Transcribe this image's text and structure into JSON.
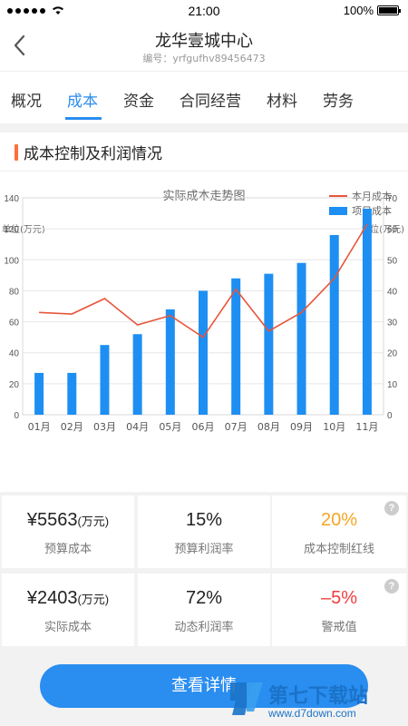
{
  "status_bar": {
    "time": "21:00",
    "battery": "100%"
  },
  "header": {
    "title": "龙华壹城中心",
    "subtitle": "编号：yrfgufhv89456473"
  },
  "tabs": [
    {
      "label": "概况",
      "active": false
    },
    {
      "label": "成本",
      "active": true
    },
    {
      "label": "资金",
      "active": false
    },
    {
      "label": "合同经营",
      "active": false
    },
    {
      "label": "材料",
      "active": false
    },
    {
      "label": "劳务",
      "active": false
    }
  ],
  "section": {
    "title": "成本控制及利润情况"
  },
  "chart_data": {
    "type": "bar",
    "title": "实际成本走势图",
    "categories": [
      "01月",
      "02月",
      "03月",
      "04月",
      "05月",
      "06月",
      "07月",
      "08月",
      "09月",
      "10月",
      "11月"
    ],
    "series": [
      {
        "name": "项目成本",
        "type": "bar",
        "axis": "left",
        "color": "#1e8ff2",
        "values": [
          27,
          27,
          45,
          52,
          68,
          80,
          88,
          91,
          98,
          116,
          133
        ]
      },
      {
        "name": "本月成本",
        "type": "line",
        "axis": "right",
        "color": "#e8553a",
        "values": [
          33,
          32.5,
          37.5,
          29,
          32,
          25,
          40.5,
          27,
          33,
          44,
          61.5
        ]
      }
    ],
    "ylabel_left": "单位(万元)",
    "ylabel_right": "单位(万元)",
    "ylim_left": [
      0,
      140
    ],
    "ylim_right": [
      0,
      70
    ],
    "yticks_left": [
      "0",
      "20",
      "40",
      "60",
      "80",
      "100",
      "120",
      "140"
    ],
    "yticks_right": [
      "0",
      "10",
      "20",
      "30",
      "40",
      "50",
      "60",
      "70"
    ],
    "grid": true,
    "legend": "top-right"
  },
  "cards": [
    {
      "value": "¥5563",
      "unit": "(万元)",
      "label": "预算成本",
      "color": "#222222",
      "help": false
    },
    {
      "value": "15%",
      "unit": "",
      "label": "预算利润率",
      "color": "#222222",
      "help": false
    },
    {
      "value": "20%",
      "unit": "",
      "label": "成本控制红线",
      "color": "#f5a623",
      "help": true
    },
    {
      "value": "¥2403",
      "unit": "(万元)",
      "label": "实际成本",
      "color": "#222222",
      "help": false
    },
    {
      "value": "72%",
      "unit": "",
      "label": "动态利润率",
      "color": "#222222",
      "help": false
    },
    {
      "value": "–5%",
      "unit": "",
      "label": "警戒值",
      "color": "#f03c3c",
      "help": true
    }
  ],
  "help_glyph": "?",
  "button": {
    "label": "查看详情"
  },
  "watermark": {
    "name": "第七下载站",
    "url": "www.d7down.com"
  }
}
